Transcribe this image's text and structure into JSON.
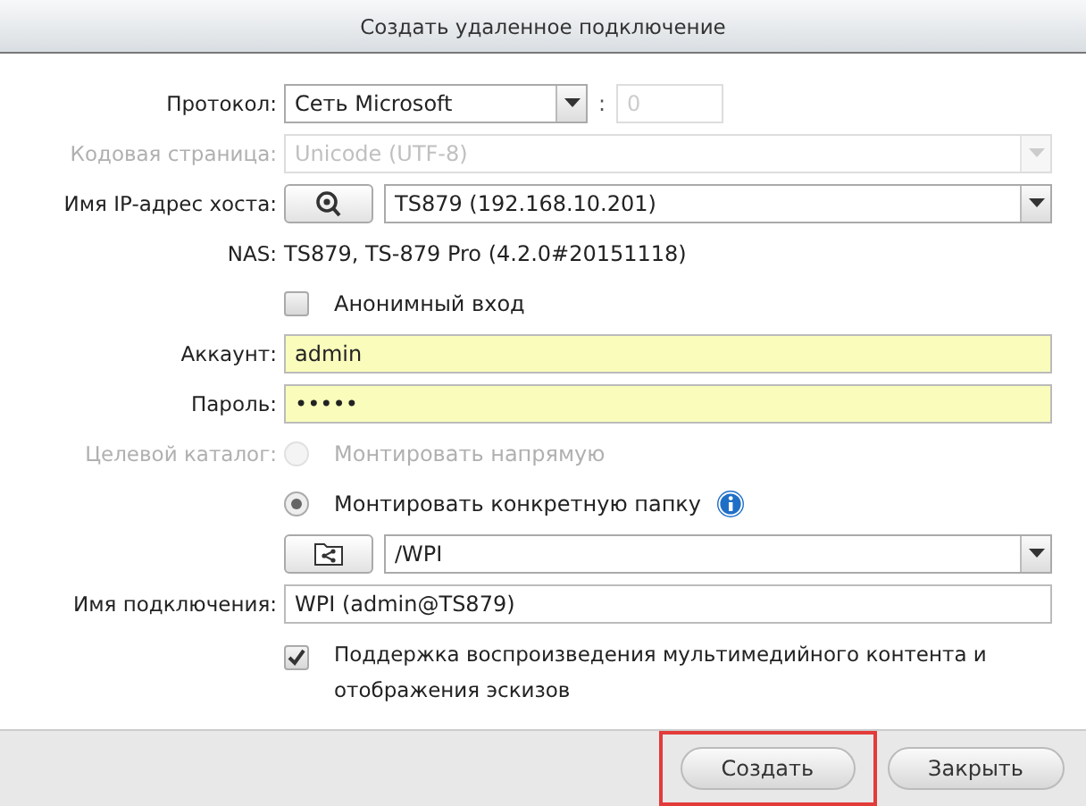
{
  "window": {
    "title": "Создать удаленное подключение"
  },
  "protocol": {
    "label": "Протокол:",
    "value": "Сеть Microsoft",
    "separator": ":",
    "port": "0",
    "port_disabled": true
  },
  "codepage": {
    "label": "Кодовая страница:",
    "value": "Unicode (UTF-8)",
    "disabled": true
  },
  "host": {
    "label": "Имя IP-адрес хоста:",
    "value": "TS879 (192.168.10.201)"
  },
  "nas": {
    "label": "NAS:",
    "value": "TS879, TS-879 Pro (4.2.0#20151118)"
  },
  "anonymous": {
    "label": "Анонимный вход",
    "checked": false
  },
  "account": {
    "label": "Аккаунт:",
    "value": "admin",
    "autofilled": true
  },
  "password": {
    "label": "Пароль:",
    "value": "•••••",
    "autofilled": true
  },
  "target": {
    "label": "Целевой каталог:",
    "disabled": true,
    "options": [
      {
        "label": "Монтировать напрямую",
        "selected": false,
        "disabled": true
      },
      {
        "label": "Монтировать конкретную папку",
        "selected": true,
        "disabled": false,
        "info": true
      }
    ]
  },
  "folder": {
    "value": "/WPI"
  },
  "connection_name": {
    "label": "Имя подключения:",
    "value": "WPI (admin@TS879)"
  },
  "media": {
    "label": "Поддержка воспроизведения мультимедийного контента и отображения эскизов",
    "checked": true
  },
  "buttons": [
    {
      "label": "Создать",
      "highlighted": true
    },
    {
      "label": "Закрыть",
      "highlighted": false
    }
  ]
}
